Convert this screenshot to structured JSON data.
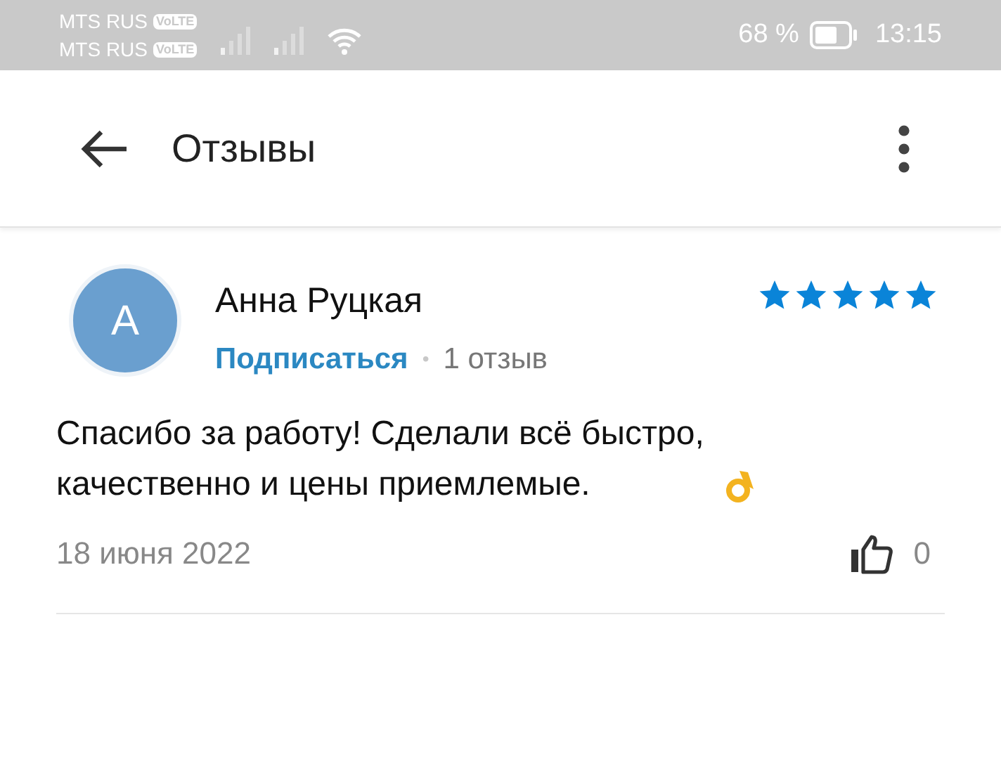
{
  "status_bar": {
    "carriers": [
      {
        "name": "MTS RUS",
        "badge": "VoLTE"
      },
      {
        "name": "MTS RUS",
        "badge": "VoLTE"
      }
    ],
    "battery": "68 %",
    "time": "13:15"
  },
  "header": {
    "title": "Отзывы"
  },
  "review": {
    "avatar_letter": "А",
    "author": "Анна Руцкая",
    "subscribe": "Подписаться",
    "separator": "•",
    "review_count": "1 отзыв",
    "stars": 5,
    "text": "Спасибо за работу! Сделали всё быстро, качественно и цены приемлемые.",
    "date": "18 июня 2022",
    "likes": "0"
  }
}
